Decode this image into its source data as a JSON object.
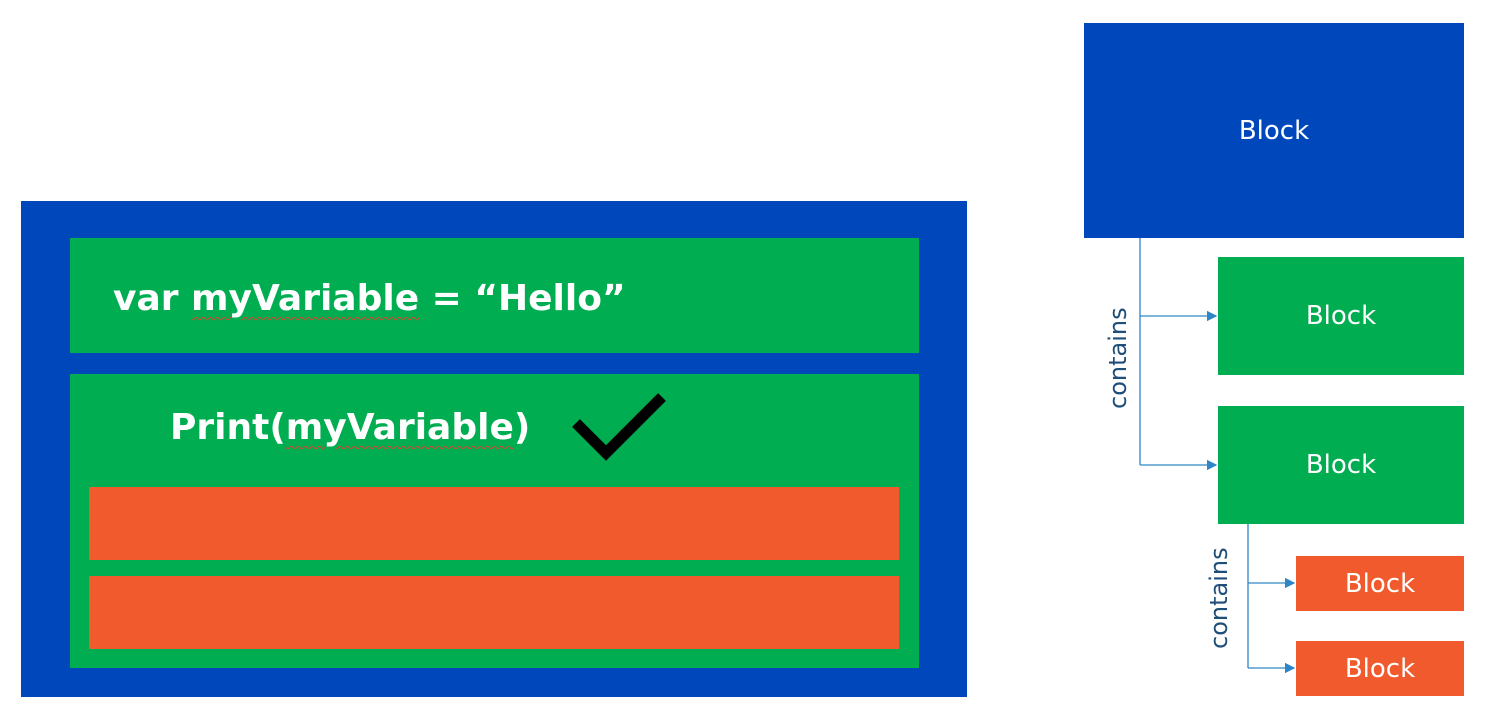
{
  "code_panel": {
    "line1": {
      "prefix": "var ",
      "identifier": "myVariable",
      "suffix": " = “Hello”"
    },
    "line2": {
      "prefix": "Print(",
      "identifier": "myVariable",
      "suffix": ")"
    },
    "check_icon": "checkmark-icon"
  },
  "tree": {
    "root_label": "Block",
    "children": [
      {
        "label": "Block"
      },
      {
        "label": "Block"
      }
    ],
    "grandchildren": [
      {
        "label": "Block"
      },
      {
        "label": "Block"
      }
    ],
    "edge_labels": [
      "contains",
      "contains"
    ]
  },
  "colors": {
    "blue": "#0047BB",
    "green": "#00AD50",
    "orange": "#F05A2C",
    "connector": "#2E86C8",
    "label_text": "#1F4E79"
  }
}
